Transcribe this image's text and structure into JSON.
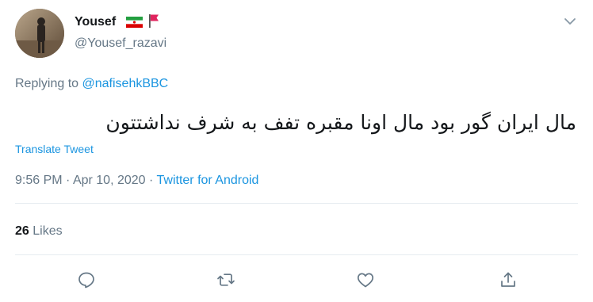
{
  "user": {
    "display_name": "Yousef",
    "handle": "@Yousef_razavi"
  },
  "reply": {
    "prefix": "Replying to ",
    "to": "@nafisehkBBC"
  },
  "tweet": {
    "text": "مال ایران گور بود مال اونا مقبره تفف به شرف نداشتتون"
  },
  "translate_label": "Translate Tweet",
  "meta": {
    "time": "9:56 PM",
    "sep1": " · ",
    "date": "Apr 10, 2020",
    "sep2": " · ",
    "source": "Twitter for Android"
  },
  "stats": {
    "likes_count": "26",
    "likes_label": "Likes"
  },
  "icons": {
    "menu": "chevron-down-icon",
    "reply": "reply-icon",
    "retweet": "retweet-icon",
    "like": "heart-icon",
    "share": "share-icon"
  },
  "colors": {
    "link": "#1b95e0",
    "muted": "#657786",
    "text": "#14171a",
    "divider": "#e6ecf0"
  }
}
